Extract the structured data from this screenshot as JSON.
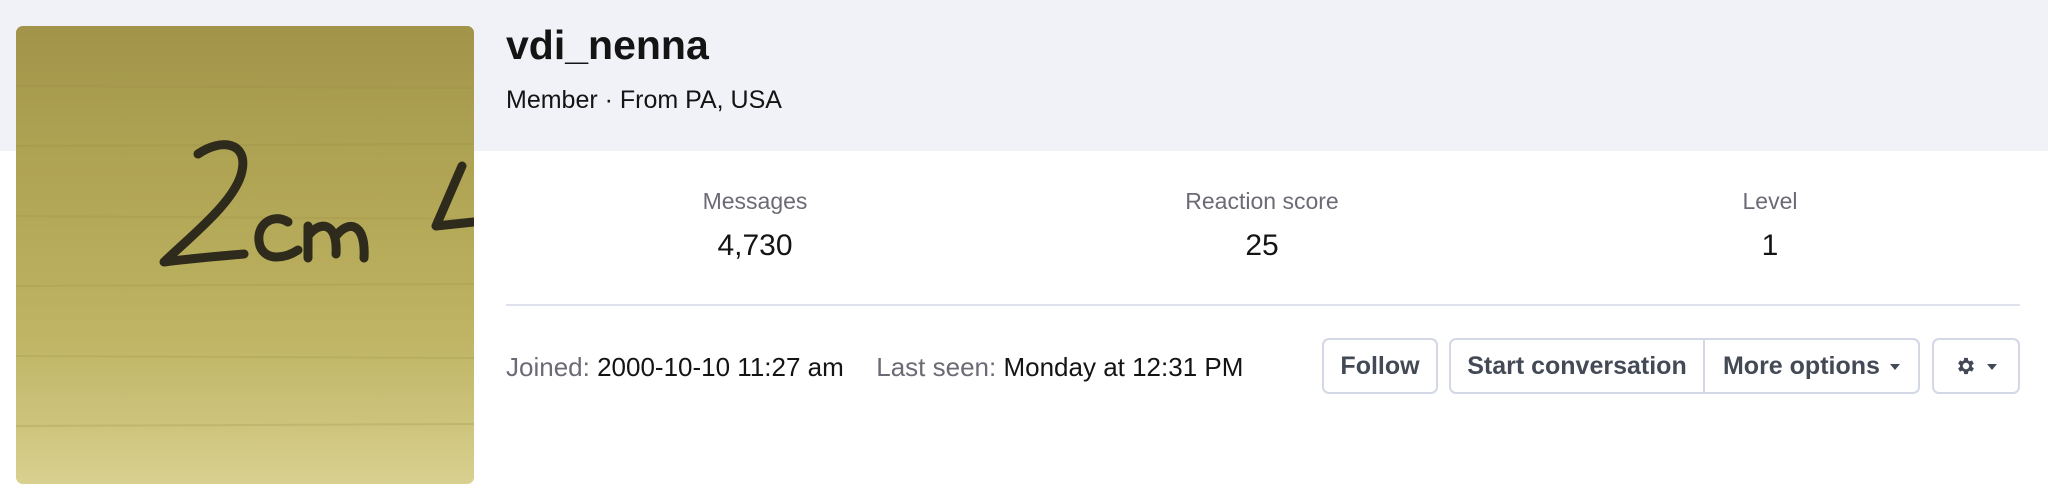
{
  "profile": {
    "username": "vdi_nenna",
    "member_line": "Member · From PA, USA"
  },
  "stats": [
    {
      "label": "Messages",
      "value": "4,730"
    },
    {
      "label": "Reaction score",
      "value": "25"
    },
    {
      "label": "Level",
      "value": "1"
    }
  ],
  "meta": {
    "joined_label": "Joined:",
    "joined_value": "2000-10-10 11:27 am",
    "last_seen_label": "Last seen:",
    "last_seen_value": "Monday at 12:31 PM"
  },
  "actions": {
    "follow": "Follow",
    "start_conversation": "Start conversation",
    "more_options": "More options"
  },
  "icons": {
    "more_caret": "chevron-down-icon",
    "settings": "gear-icon"
  },
  "colors": {
    "header_band": "#f1f2f7",
    "button_border": "#d3d7e6",
    "button_text": "#444a55",
    "muted_text": "#6b6b75"
  }
}
